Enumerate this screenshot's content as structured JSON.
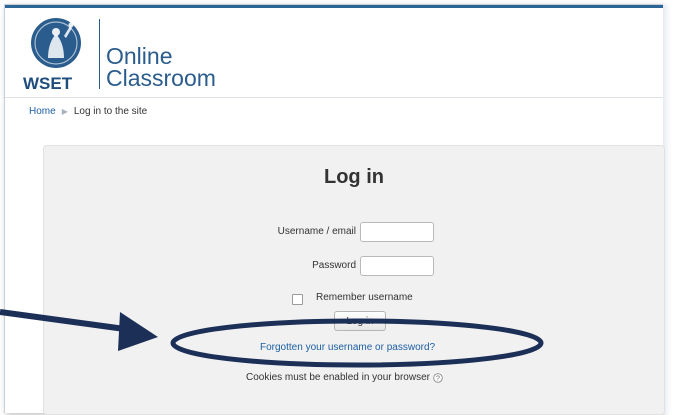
{
  "logo": {
    "brand": "WSET",
    "title_line1": "Online",
    "title_line2": "Classroom"
  },
  "breadcrumb": {
    "home": "Home",
    "current": "Log in to the site"
  },
  "login": {
    "heading": "Log in",
    "username_label": "Username / email",
    "username_value": "",
    "password_label": "Password",
    "password_value": "",
    "remember_label": "Remember username",
    "remember_checked": false,
    "button_label": "Log in",
    "forgot_link": "Forgotten your username or password?",
    "cookies_note": "Cookies must be enabled in your browser"
  },
  "colors": {
    "brand_blue": "#2a5c8d",
    "link_blue": "#1c5fa3",
    "annotation_navy": "#1c2f57"
  }
}
